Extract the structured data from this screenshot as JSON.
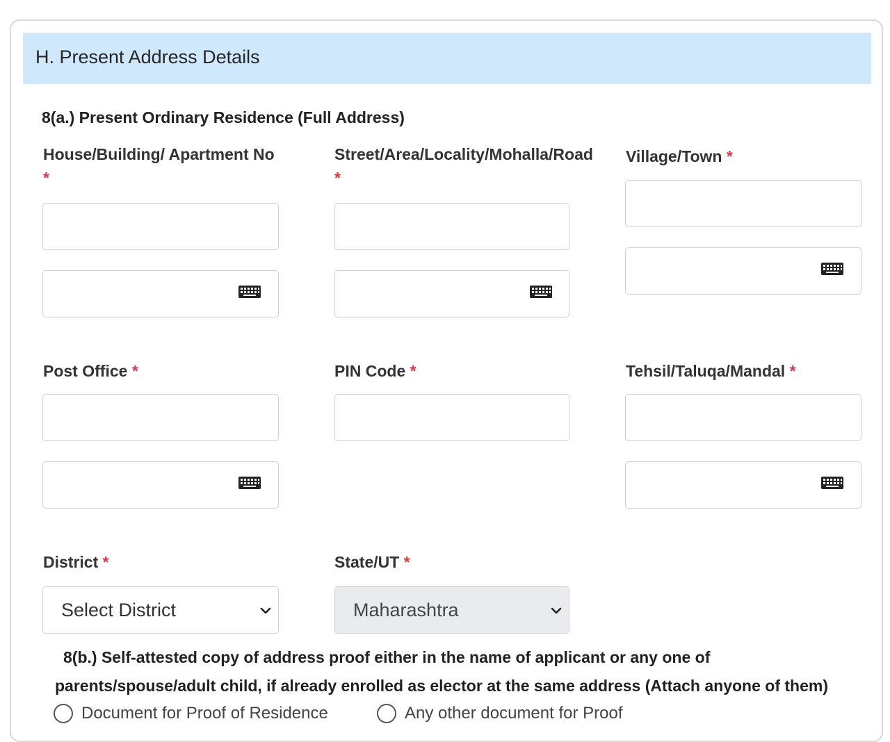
{
  "section": {
    "title": "H. Present Address Details"
  },
  "subsection_a": {
    "title": "8(a.) Present Ordinary Residence (Full Address)"
  },
  "fields": {
    "house": {
      "label": "House/Building/ Apartment No",
      "required_mark": "*"
    },
    "street": {
      "label": "Street/Area/Locality/Mohalla/Road",
      "required_mark": "*"
    },
    "village": {
      "label": "Village/Town",
      "required_mark": "*"
    },
    "post_office": {
      "label": "Post Office",
      "required_mark": "*"
    },
    "pin": {
      "label": "PIN Code",
      "required_mark": "*"
    },
    "tehsil": {
      "label": "Tehsil/Taluqa/Mandal",
      "required_mark": "*"
    },
    "district": {
      "label": "District",
      "required_mark": "*",
      "selected": "Select District"
    },
    "state": {
      "label": "State/UT",
      "required_mark": "*",
      "selected": "Maharashtra"
    }
  },
  "subsection_b": {
    "line1": "8(b.) Self-attested copy of address proof either in the name of applicant or any one of",
    "line2": "parents/spouse/adult child, if already enrolled as elector at the same address (Attach anyone of them)"
  },
  "proof_options": [
    {
      "label": "Document for Proof of Residence"
    },
    {
      "label": "Any other document for Proof"
    }
  ],
  "icons": {
    "keyboard": "keyboard-icon",
    "dropdown": "chevron-down-icon",
    "radio": "radio-button"
  },
  "colors": {
    "header_bg": "#cfe8fc",
    "required": "#dc3545",
    "border": "#cfcfcf",
    "disabled_bg": "#e9ecef"
  }
}
